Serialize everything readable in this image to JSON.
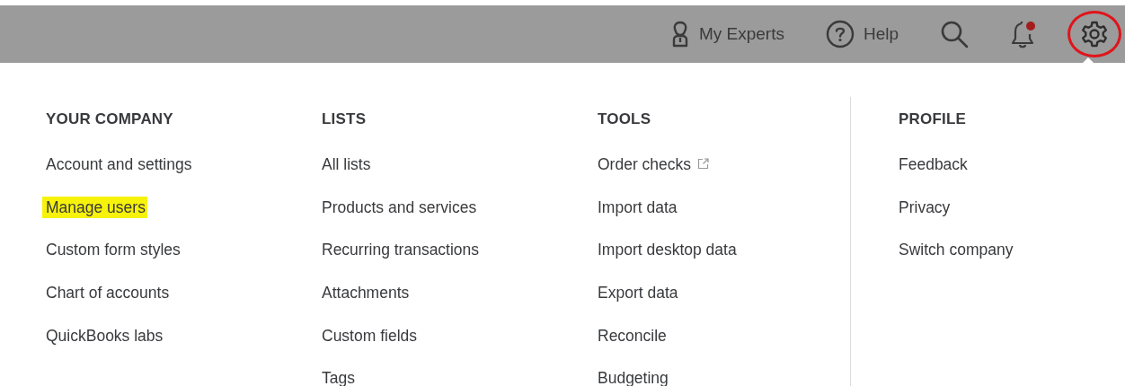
{
  "toolbar": [
    {
      "kind": "experts",
      "label": "My Experts",
      "circled": false
    },
    {
      "kind": "help",
      "label": "Help",
      "circled": false
    },
    {
      "kind": "search",
      "circled": false
    },
    {
      "kind": "notifications",
      "badge": true,
      "circled": false
    },
    {
      "kind": "settings",
      "circled": true
    }
  ],
  "menu": {
    "columns": [
      {
        "heading": "YOUR COMPANY",
        "items": [
          {
            "label": "Account and settings",
            "kind": "link",
            "highlighted": false
          },
          {
            "label": "Manage users",
            "kind": "link",
            "highlighted": true
          },
          {
            "label": "Custom form styles",
            "kind": "link",
            "highlighted": false
          },
          {
            "label": "Chart of accounts",
            "kind": "link",
            "highlighted": false
          },
          {
            "label": "QuickBooks labs",
            "kind": "link",
            "highlighted": false
          }
        ]
      },
      {
        "heading": "LISTS",
        "items": [
          {
            "label": "All lists",
            "kind": "link",
            "highlighted": false
          },
          {
            "label": "Products and services",
            "kind": "link",
            "highlighted": false
          },
          {
            "label": "Recurring transactions",
            "kind": "link",
            "highlighted": false
          },
          {
            "label": "Attachments",
            "kind": "link",
            "highlighted": false
          },
          {
            "label": "Custom fields",
            "kind": "link",
            "highlighted": false
          },
          {
            "label": "Tags",
            "kind": "link",
            "highlighted": false
          }
        ]
      },
      {
        "heading": "TOOLS",
        "items": [
          {
            "label": "Order checks",
            "kind": "external",
            "highlighted": false
          },
          {
            "label": "Import data",
            "kind": "link",
            "highlighted": false
          },
          {
            "label": "Import desktop data",
            "kind": "link",
            "highlighted": false
          },
          {
            "label": "Export data",
            "kind": "link",
            "highlighted": false
          },
          {
            "label": "Reconcile",
            "kind": "link",
            "highlighted": false
          },
          {
            "label": "Budgeting",
            "kind": "link",
            "highlighted": false
          }
        ]
      },
      {
        "heading": "PROFILE",
        "items": [
          {
            "label": "Feedback",
            "kind": "link",
            "highlighted": false
          },
          {
            "label": "Privacy",
            "kind": "link",
            "highlighted": false
          },
          {
            "label": "Switch company",
            "kind": "link",
            "highlighted": false
          }
        ]
      }
    ]
  }
}
